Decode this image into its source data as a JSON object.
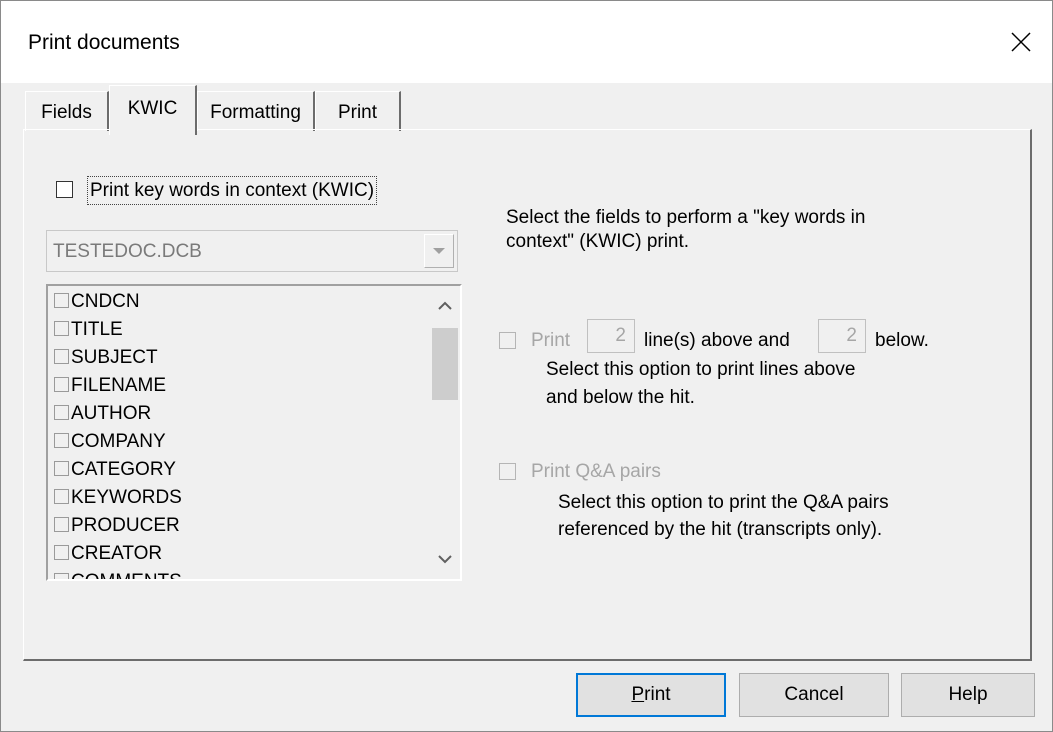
{
  "window": {
    "title": "Print documents"
  },
  "tabs": [
    {
      "label": "Fields",
      "active": false
    },
    {
      "label": "KWIC",
      "active": true
    },
    {
      "label": "Formatting",
      "active": false
    },
    {
      "label": "Print",
      "active": false
    }
  ],
  "kwic": {
    "checkbox_label": "Print key words in context (KWIC)",
    "checked": false,
    "database_select": {
      "value": "TESTEDOC.DCB"
    },
    "fields": [
      "CNDCN",
      "TITLE",
      "SUBJECT",
      "FILENAME",
      "AUTHOR",
      "COMPANY",
      "CATEGORY",
      "KEYWORDS",
      "PRODUCER",
      "CREATOR",
      "COMMENTS"
    ],
    "description": "Select the fields to perform a \"key words in context\" (KWIC) print.",
    "lines_option": {
      "label_print": "Print",
      "above_value": "2",
      "mid_label": "line(s) above and",
      "below_value": "2",
      "end_label": "below.",
      "description_line1": "Select this option to print lines above",
      "description_line2": "and below the hit."
    },
    "qa_option": {
      "label": "Print Q&A pairs",
      "description_line1": "Select this option to print the Q&A pairs",
      "description_line2": "referenced by the hit (transcripts only)."
    }
  },
  "buttons": {
    "print_mnemonic": "P",
    "print_rest": "rint",
    "cancel": "Cancel",
    "help": "Help"
  },
  "icons": [
    "close-icon",
    "dropdown-arrow-icon",
    "scroll-up-icon",
    "scroll-down-icon"
  ]
}
